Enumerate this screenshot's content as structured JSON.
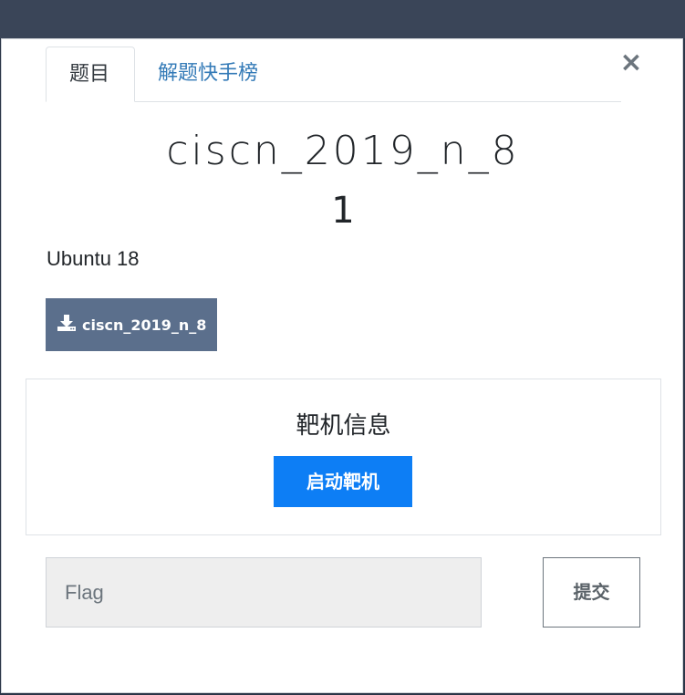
{
  "tabs": [
    {
      "label": "题目",
      "active": true
    },
    {
      "label": "解题快手榜",
      "active": false
    }
  ],
  "close_glyph": "×",
  "challenge": {
    "name": "ciscn_2019_n_8",
    "points": "1",
    "description": "Ubuntu 18",
    "file_label": "ciscn_2019_n_8"
  },
  "target": {
    "heading": "靶机信息",
    "start_label": "启动靶机"
  },
  "flag": {
    "placeholder": "Flag",
    "value": "",
    "submit_label": "提交"
  },
  "icons": {
    "download": "download-icon",
    "close": "close-icon"
  },
  "colors": {
    "link": "#337ab7",
    "download_bg": "#5b6f8c",
    "primary": "#0d7ef5"
  }
}
